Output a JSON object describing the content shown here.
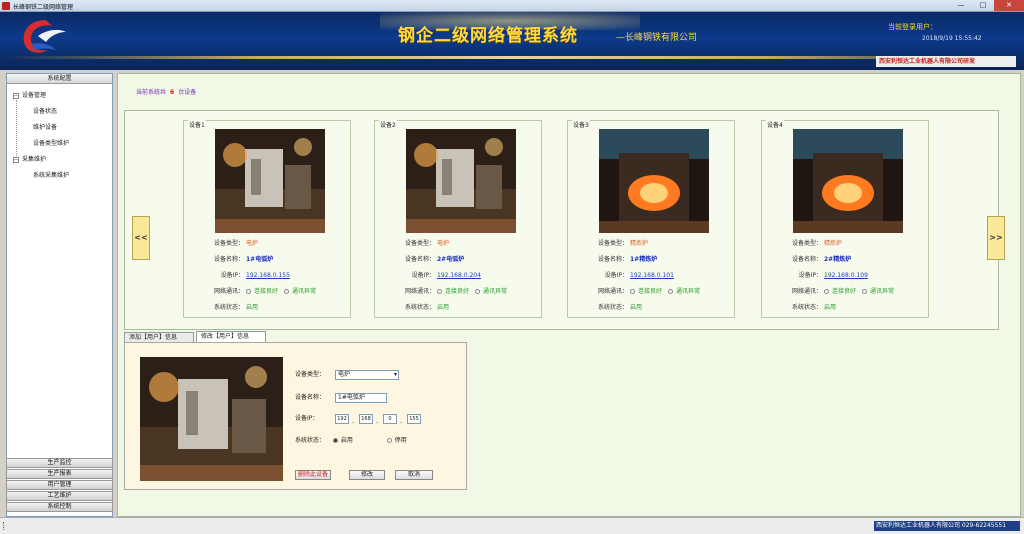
{
  "window": {
    "title": "长峰钢铁二级网络管理",
    "min_glyph": "—",
    "max_glyph": "□",
    "close_glyph": "✕"
  },
  "header": {
    "title": "钢企二级网络管理系统",
    "subtitle": "—长峰钢铁有限公司",
    "current_user_label": "当前登录用户：",
    "datetime": "2018/9/19 15:55:42",
    "company": "西安利恒达工业机器人有限公司研发"
  },
  "sidebar": {
    "header": "系统配置",
    "tree": [
      {
        "label": "设备管理",
        "toggle": "−",
        "level": 0
      },
      {
        "label": "设备状态",
        "level": 1
      },
      {
        "label": "维护设备",
        "level": 1
      },
      {
        "label": "设备类型维护",
        "level": 1
      },
      {
        "label": "采集维护",
        "toggle": "−",
        "level": 0
      },
      {
        "label": "系统采集维护",
        "level": 1
      }
    ],
    "bottom_menu": [
      "生产监控",
      "生产报表",
      "用户管理",
      "工艺维护",
      "系统控制"
    ]
  },
  "main": {
    "summary_label": "当前系统共",
    "summary_count": "6",
    "summary_unit": "台设备",
    "prev_label": "<<",
    "next_label": ">>",
    "field_labels": {
      "type": "设备类型：",
      "name": "设备名称：",
      "ip": "设备IP：",
      "network": "网络通讯：",
      "state": "系统状态："
    },
    "net_options": [
      "连接良好",
      "通讯异常"
    ],
    "devices": [
      {
        "caption": "设备1",
        "type": "电炉",
        "name": "1#电弧炉",
        "ip": "192.168.0.155",
        "state": "启用"
      },
      {
        "caption": "设备2",
        "type": "电炉",
        "name": "2#电弧炉",
        "ip": "192.168.0.204",
        "state": "启用"
      },
      {
        "caption": "设备3",
        "type": "精炼炉",
        "name": "1#精炼炉",
        "ip": "192.168.0.101",
        "state": "启用"
      },
      {
        "caption": "设备4",
        "type": "精炼炉",
        "name": "2#精炼炉",
        "ip": "192.168.0.109",
        "state": "启用"
      }
    ]
  },
  "detail": {
    "tab1": "添加【用户】信息",
    "tab2": "修改【用户】信息",
    "type_label": "设备类型：",
    "type_value": "电炉",
    "name_label": "设备名称：",
    "name_value": "1#电弧炉",
    "ip_label": "设备IP：",
    "ip_parts": [
      "192",
      "168",
      "0",
      "155"
    ],
    "state_label": "系统状态：",
    "state_on": "启用",
    "state_off": "停用",
    "delete_btn": "删除此设备",
    "modify_btn": "修改",
    "cancel_btn": "取消"
  },
  "status": {
    "text": "西安利恒达工业机器人有限公司 029-62245551"
  },
  "colors": {
    "banner": "#0d3a8a",
    "title_gold": "#ffd93d",
    "main_bg": "#f1f8e6",
    "type_orange": "#e65a1a",
    "name_blue": "#1a2bb8",
    "state_green": "#2a9a2a"
  }
}
